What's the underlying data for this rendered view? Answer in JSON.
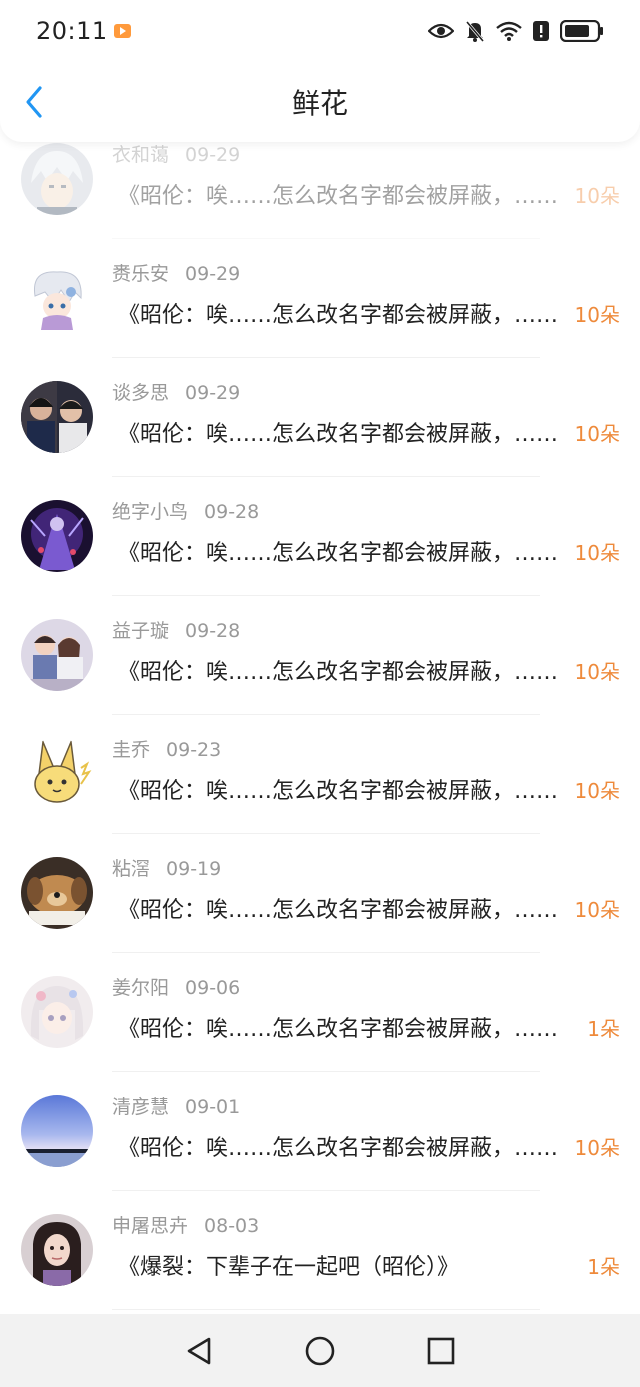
{
  "status": {
    "time": "20:11"
  },
  "header": {
    "title": "鲜花"
  },
  "colors": {
    "accent": "#2196F3",
    "flowers": "#EE8A3B",
    "meta": "#999999"
  },
  "items": [
    {
      "name": "衣和蔼",
      "date": "09-29",
      "content": "《昭伦：唉……怎么改名字都会被屏蔽，……",
      "flowers": "10朵",
      "avatar": "anime-silver-hair"
    },
    {
      "name": "赉乐安",
      "date": "09-29",
      "content": "《昭伦：唉……怎么改名字都会被屏蔽，……",
      "flowers": "10朵",
      "avatar": "chibi-white-hair"
    },
    {
      "name": "谈多思",
      "date": "09-29",
      "content": "《昭伦：唉……怎么改名字都会被屏蔽，……",
      "flowers": "10朵",
      "avatar": "photo-people"
    },
    {
      "name": "绝字小鸟",
      "date": "09-28",
      "content": "《昭伦：唉……怎么改名字都会被屏蔽，……",
      "flowers": "10朵",
      "avatar": "game-purple"
    },
    {
      "name": "益子璇",
      "date": "09-28",
      "content": "《昭伦：唉……怎么改名字都会被屏蔽，……",
      "flowers": "10朵",
      "avatar": "photo-couple"
    },
    {
      "name": "圭乔",
      "date": "09-23",
      "content": "《昭伦：唉……怎么改名字都会被屏蔽，……",
      "flowers": "10朵",
      "avatar": "yellow-creature"
    },
    {
      "name": "粘滘",
      "date": "09-19",
      "content": "《昭伦：唉……怎么改名字都会被屏蔽，……",
      "flowers": "10朵",
      "avatar": "puppy"
    },
    {
      "name": "姜尔阳",
      "date": "09-06",
      "content": "《昭伦：唉……怎么改名字都会被屏蔽，……",
      "flowers": "1朵",
      "avatar": "anime-pastel-girl"
    },
    {
      "name": "清彦慧",
      "date": "09-01",
      "content": "《昭伦：唉……怎么改名字都会被屏蔽，……",
      "flowers": "10朵",
      "avatar": "sky-landscape"
    },
    {
      "name": "申屠思卉",
      "date": "08-03",
      "content": "《爆裂：下辈子在一起吧（昭伦）》",
      "flowers": "1朵",
      "avatar": "photo-woman"
    }
  ]
}
